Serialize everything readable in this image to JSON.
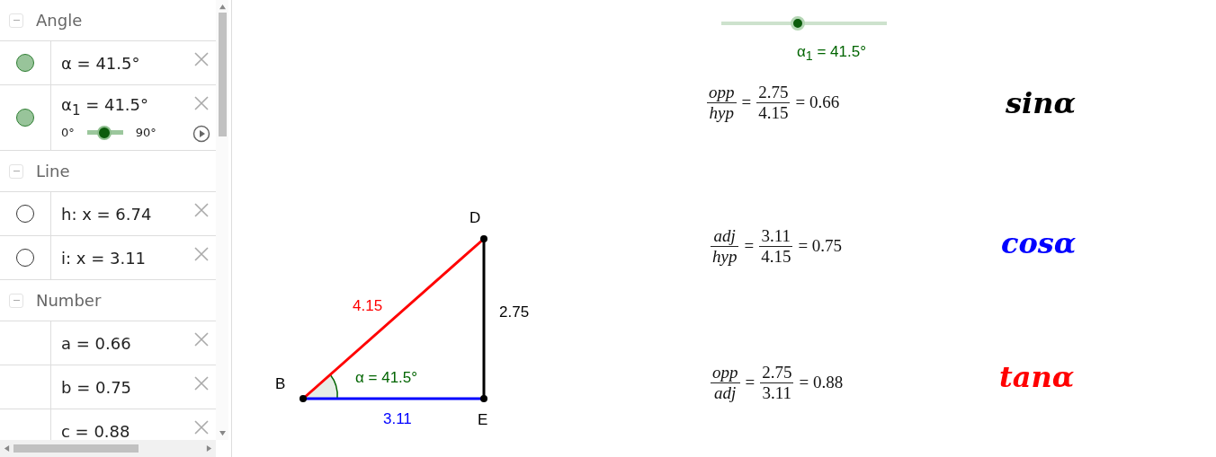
{
  "algebra": {
    "groups": [
      {
        "title": "Angle",
        "expanded": true,
        "items": [
          {
            "kind": "angle",
            "text": "α = 41.5°",
            "visible": true
          },
          {
            "kind": "slider",
            "text": "α$_{1}$ = 41.5°",
            "visible": true,
            "min": "0°",
            "max": "90°",
            "level": 0.47
          }
        ]
      },
      {
        "title": "Line",
        "expanded": true,
        "items": [
          {
            "kind": "line",
            "text": "h: x = 6.74",
            "visible": false
          },
          {
            "kind": "line",
            "text": "i: x = 3.11",
            "visible": false
          }
        ]
      },
      {
        "title": "Number",
        "expanded": true,
        "items": [
          {
            "kind": "number",
            "text": "a = 0.66"
          },
          {
            "kind": "number",
            "text": "b = 0.75"
          },
          {
            "kind": "number",
            "text": "c = 0.88"
          }
        ]
      }
    ]
  },
  "graphics": {
    "slider": {
      "label": "α$_{1}$ = 41.5°",
      "level": 0.46
    },
    "triangle": {
      "points": [
        "B",
        "D",
        "E"
      ],
      "hypotenuse": "4.15",
      "opposite": "2.75",
      "adjacent": "3.11",
      "angle": "α = 41.5°"
    },
    "formulas": [
      {
        "num": "opp",
        "den": "hyp",
        "eq": "=",
        "num2": "2.75",
        "den2": "4.15",
        "result": "= 0.66",
        "function": "sinα",
        "color": "#000000"
      },
      {
        "num": "adj",
        "den": "hyp",
        "eq": "=",
        "num2": "3.11",
        "den2": "4.15",
        "result": "= 0.75",
        "function": "cosα",
        "color": "#0000ff"
      },
      {
        "num": "opp",
        "den": "adj",
        "eq": "=",
        "num2": "2.75",
        "den2": "3.11",
        "result": "= 0.88",
        "function": "tanα",
        "color": "#ff0000"
      }
    ]
  }
}
